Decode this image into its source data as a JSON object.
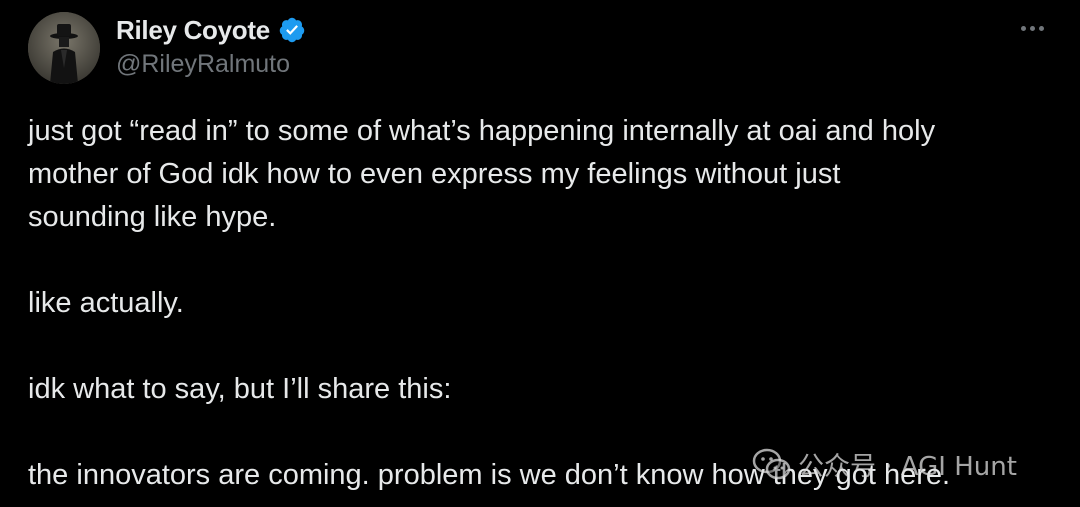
{
  "tweet": {
    "author": {
      "display_name": "Riley Coyote",
      "handle": "@RileyRalmuto",
      "verified": true,
      "avatar_icon": "avatar-figure-in-hat",
      "verified_color": "#1d9bf0"
    },
    "more_icon": "more-horizontal-icon",
    "paragraphs": [
      {
        "lines": [
          "just got “read in” to some of what’s happening internally at oai and holy",
          "mother of God idk how to even express my feelings without just",
          "sounding like hype."
        ]
      },
      {
        "lines": [
          "like actually."
        ]
      },
      {
        "lines": [
          "idk what to say, but I’ll share this:"
        ]
      },
      {
        "lines": [
          "the innovators are coming. problem is we don’t know how they got here."
        ]
      }
    ]
  },
  "watermark": {
    "text": "公众号 · AGI Hunt",
    "icon": "wechat-icon"
  },
  "colors": {
    "background": "#000000",
    "text_primary": "#e7e9ea",
    "text_secondary": "#71767b"
  }
}
